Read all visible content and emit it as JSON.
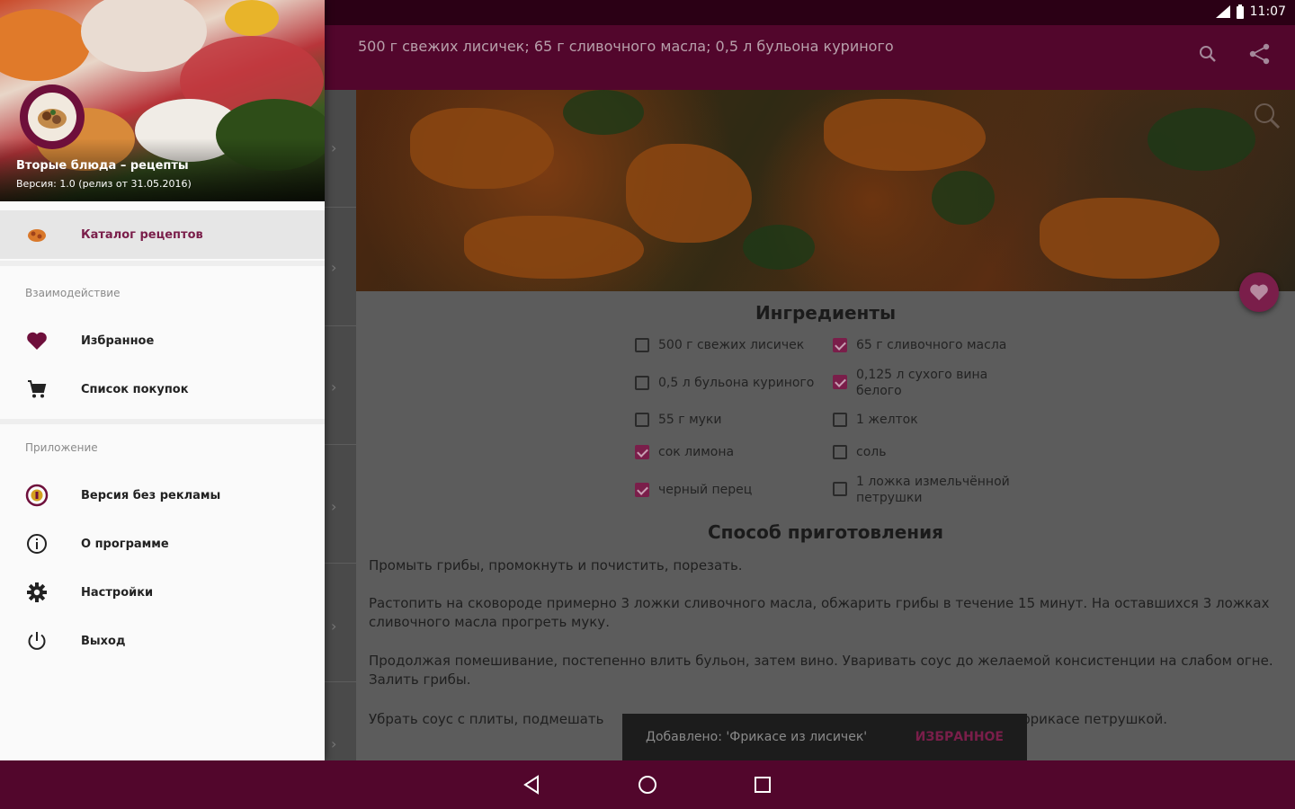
{
  "status_bar": {
    "time": "11:07"
  },
  "app_bar": {
    "title": "500 г свежих лисичек; 65 г сливочного масла; 0,5 л бульона куриного",
    "icons": [
      "search-icon",
      "share-icon"
    ]
  },
  "drawer": {
    "app_name": "Вторые блюда – рецепты",
    "version": "Версия: 1.0 (релиз от 31.05.2016)",
    "items": [
      {
        "label": "Каталог рецептов",
        "icon": "catalog-icon",
        "selected": true
      }
    ],
    "section_interaction": "Взаимодействие",
    "interaction_items": [
      {
        "label": "Избранное",
        "icon": "heart-icon"
      },
      {
        "label": "Список покупок",
        "icon": "cart-icon"
      }
    ],
    "section_app": "Приложение",
    "app_items": [
      {
        "label": "Версия без рекламы",
        "icon": "coin-icon"
      },
      {
        "label": "О программе",
        "icon": "info-icon"
      },
      {
        "label": "Настройки",
        "icon": "gear-icon"
      },
      {
        "label": "Выход",
        "icon": "power-icon"
      }
    ]
  },
  "recipe": {
    "ingredients_title": "Ингредиенты",
    "ingredients_left": [
      {
        "text": "500 г свежих лисичек",
        "checked": false
      },
      {
        "text": "0,5 л бульона куриного",
        "checked": false
      },
      {
        "text": "55 г муки",
        "checked": false
      },
      {
        "text": "сок лимона",
        "checked": true
      },
      {
        "text": "черный перец",
        "checked": true
      }
    ],
    "ingredients_right": [
      {
        "text": "65 г сливочного масла",
        "checked": true
      },
      {
        "text": "0,125 л сухого вина белого",
        "checked": true
      },
      {
        "text": "1 желток",
        "checked": false
      },
      {
        "text": "соль",
        "checked": false
      },
      {
        "text": "1 ложка измельчённой петрушки",
        "checked": false
      }
    ],
    "method_title": "Способ приготовления",
    "steps": [
      "Промыть грибы, промокнуть и почистить, порезать.",
      "Растопить на сковороде примерно 3 ложки сливочного масла, обжарить грибы в течение 15 минут. На оставшихся 3 ложках сливочного масла прогреть муку.",
      "Продолжая помешивание, постепенно влить бульон, затем вино. Уваривать соус до желаемой консистенции на слабом огне. Залить грибы.",
      "Убрать соус с плиты, подмешать                                                                      чить. Посыпать фрикасе петрушкой."
    ]
  },
  "snackbar": {
    "message": "Добавлено: 'Фрикасе из лисичек'",
    "action": "ИЗБРАННОЕ"
  },
  "colors": {
    "primary": "#52062c",
    "accent": "#7a1e4a"
  }
}
